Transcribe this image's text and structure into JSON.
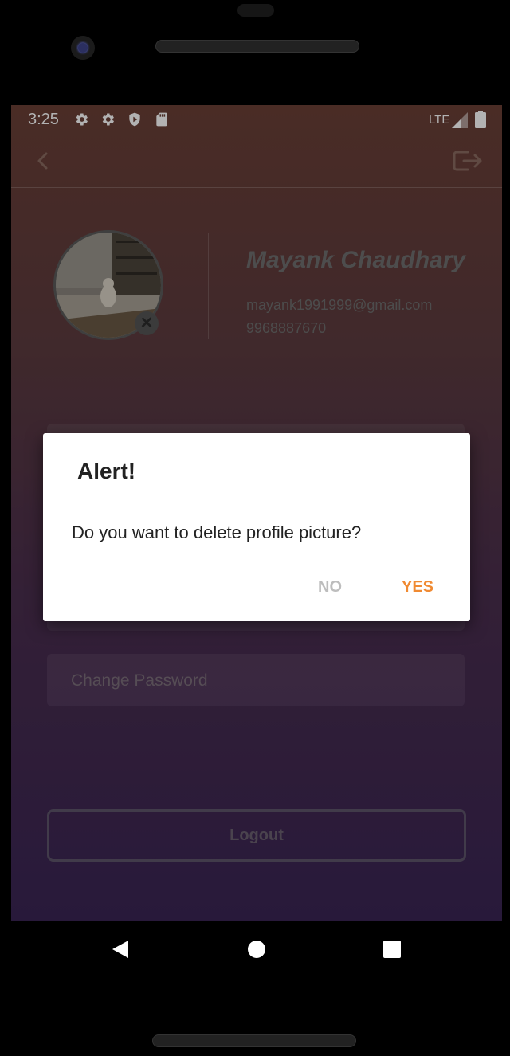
{
  "status_bar": {
    "time": "3:25",
    "network": "LTE",
    "icons": [
      "gear-icon",
      "gear-icon",
      "shield-icon",
      "sd-card-icon",
      "signal-icon",
      "battery-icon"
    ]
  },
  "toolbar": {
    "back_icon": "chevron-left-icon",
    "logout_icon": "logout-icon"
  },
  "profile": {
    "name": "Mayank Chaudhary",
    "email": "mayank1991999@gmail.com",
    "phone": "9968887670"
  },
  "form": {
    "change_password_label": "Change Password",
    "logout_label": "Logout"
  },
  "dialog": {
    "title": "Alert!",
    "message": "Do you want to delete profile picture?",
    "no_label": "NO",
    "yes_label": "YES",
    "accent_color": "#f08a32"
  },
  "nav_bar": {
    "icons": [
      "nav-back-icon",
      "nav-home-icon",
      "nav-recents-icon"
    ]
  }
}
